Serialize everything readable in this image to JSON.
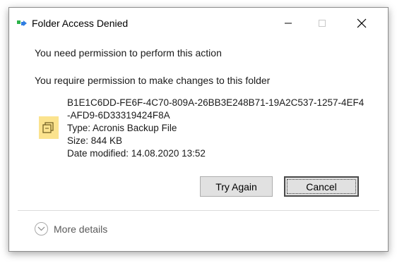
{
  "window": {
    "title": "Folder Access Denied",
    "icons": {
      "app": "folder-permission-icon",
      "minimize": "minimize-icon",
      "maximize": "maximize-icon",
      "close": "close-icon"
    }
  },
  "messages": {
    "primary": "You need permission to perform this action",
    "secondary": "You require permission to make changes to this folder"
  },
  "file": {
    "name_line1": "B1E1C6DD-FE6F-4C70-809A-26BB3E248B71-19A2C537-1257-4EF4",
    "name_line2": "-AFD9-6D33319424F8A",
    "type": "Type: Acronis Backup File",
    "size": "Size: 844 KB",
    "modified": "Date modified: 14.08.2020 13:52",
    "icon": "file-icon",
    "icon_color": "#fbe38e"
  },
  "buttons": {
    "try_again": "Try Again",
    "cancel": "Cancel"
  },
  "details": {
    "label": "More details",
    "icon": "chevron-down-icon"
  },
  "colors": {
    "button_bg": "#e1e1e1",
    "accent_blue": "#2f7de1",
    "accent_green": "#2db34a"
  }
}
